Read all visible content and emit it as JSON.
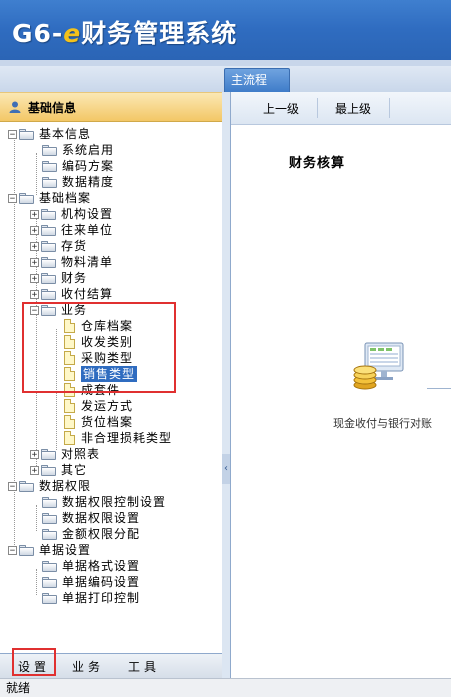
{
  "app": {
    "title_prefix": "G6-",
    "title_e": "e",
    "title_suffix": "财务管理系统"
  },
  "tabs": {
    "main": "主流程"
  },
  "left_panel": {
    "header": "基础信息"
  },
  "tree": [
    {
      "label": "基本信息"
    },
    {
      "label": "系统启用"
    },
    {
      "label": "编码方案"
    },
    {
      "label": "数据精度"
    },
    {
      "label": "基础档案"
    },
    {
      "label": "机构设置"
    },
    {
      "label": "往来单位"
    },
    {
      "label": "存货"
    },
    {
      "label": "物料清单"
    },
    {
      "label": "财务"
    },
    {
      "label": "收付结算"
    },
    {
      "label": "业务"
    },
    {
      "label": "仓库档案"
    },
    {
      "label": "收发类别"
    },
    {
      "label": "采购类型"
    },
    {
      "label": "销售类型"
    },
    {
      "label": "成套件"
    },
    {
      "label": "发运方式"
    },
    {
      "label": "货位档案"
    },
    {
      "label": "非合理损耗类型"
    },
    {
      "label": "对照表"
    },
    {
      "label": "其它"
    },
    {
      "label": "数据权限"
    },
    {
      "label": "数据权限控制设置"
    },
    {
      "label": "数据权限设置"
    },
    {
      "label": "金额权限分配"
    },
    {
      "label": "单据设置"
    },
    {
      "label": "单据格式设置"
    },
    {
      "label": "单据编码设置"
    },
    {
      "label": "单据打印控制"
    }
  ],
  "bottom_tabs": {
    "settings": "设置",
    "business": "业务",
    "tools": "工具"
  },
  "toolbar": {
    "up": "上一级",
    "top": "最上级"
  },
  "main": {
    "section_title": "财务核算",
    "flow_label": "现金收付与银行对账"
  },
  "status": {
    "text": "就绪"
  },
  "colors": {
    "banner": "#2f6cc0",
    "highlight": "#e03030",
    "selected": "#2f6cc0",
    "panel_header": "#f3c766"
  }
}
